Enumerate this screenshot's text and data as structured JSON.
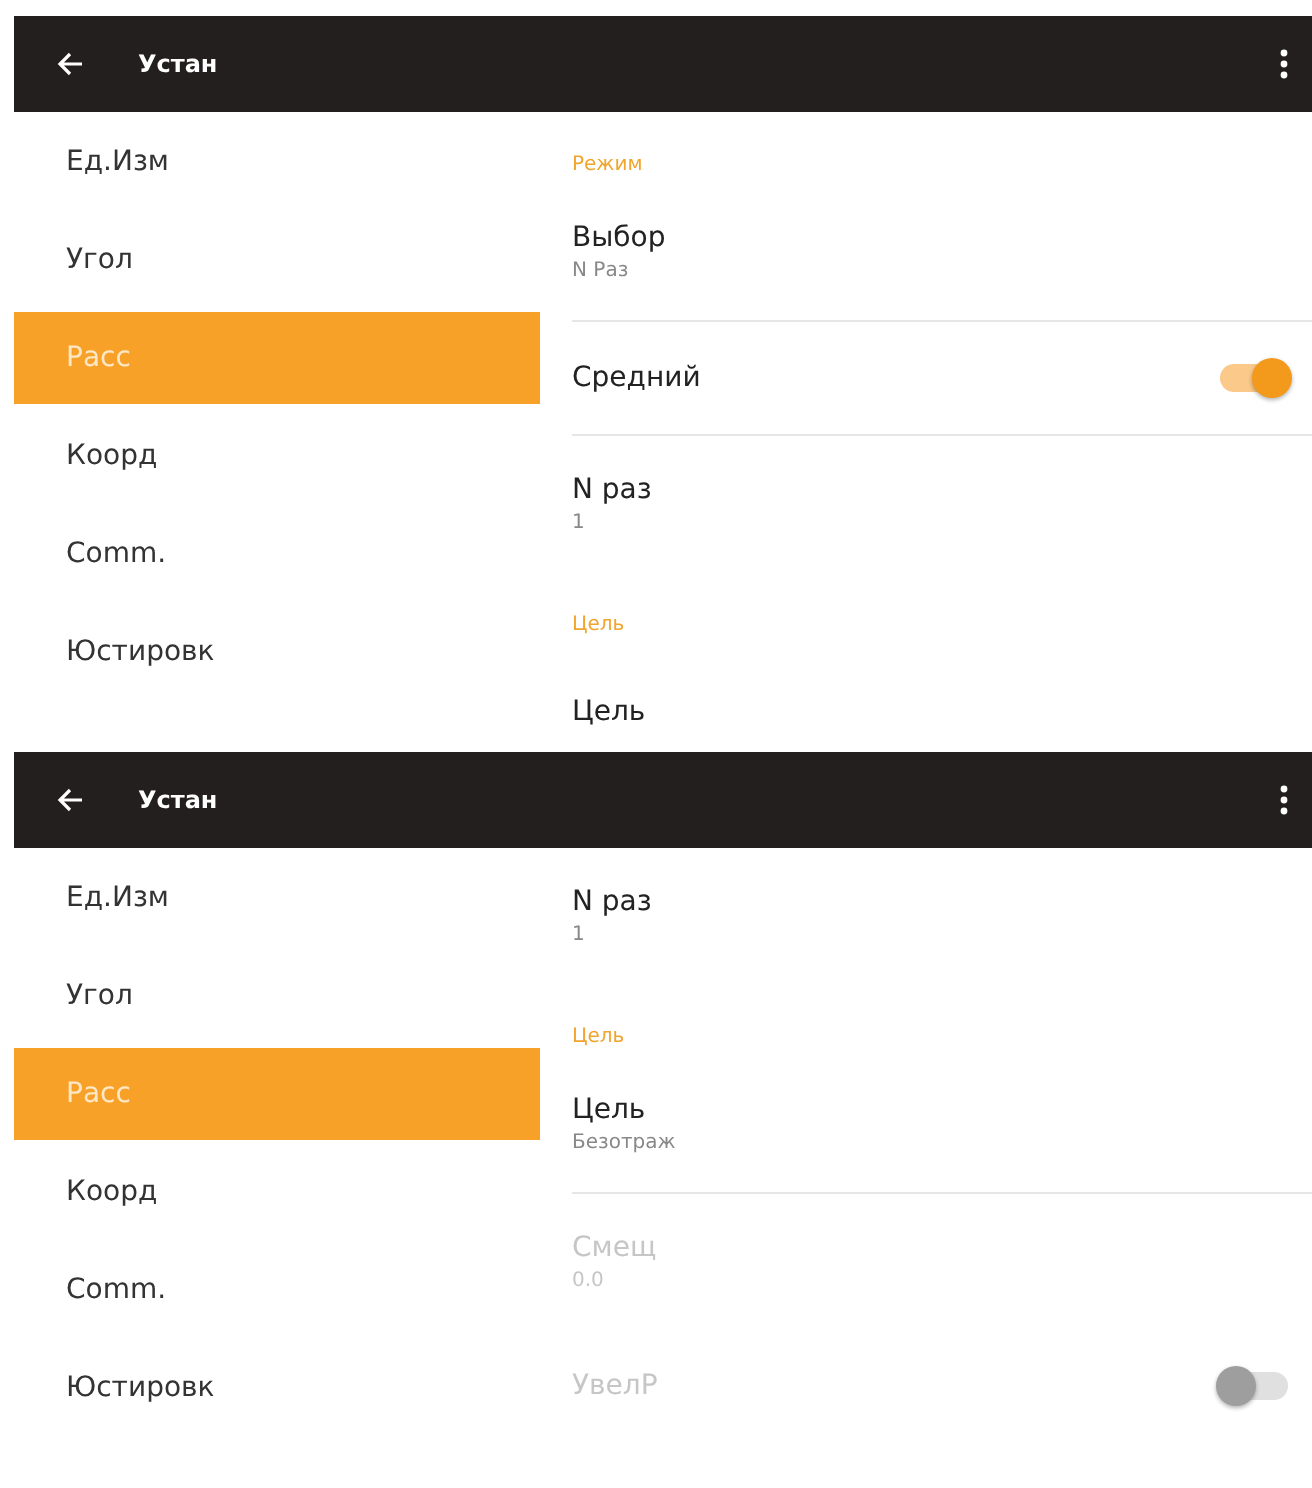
{
  "screens": [
    {
      "title": "Устан",
      "sidebar": {
        "items": [
          {
            "label": "Ед.Изм",
            "selected": false
          },
          {
            "label": "Угол",
            "selected": false
          },
          {
            "label": "Расс",
            "selected": true
          },
          {
            "label": "Коорд",
            "selected": false
          },
          {
            "label": "Comm.",
            "selected": false
          },
          {
            "label": "Юстировк",
            "selected": false
          }
        ]
      },
      "content": [
        {
          "kind": "section",
          "title": "Режим"
        },
        {
          "kind": "item",
          "title": "Выбор",
          "value": "N Раз",
          "disabled": false
        },
        {
          "kind": "divider"
        },
        {
          "kind": "toggle",
          "title": "Средний",
          "on": true,
          "disabled": false
        },
        {
          "kind": "divider"
        },
        {
          "kind": "item",
          "title": "N раз",
          "value": "1",
          "disabled": false
        },
        {
          "kind": "section",
          "title": "Цель"
        },
        {
          "kind": "item",
          "title": "Цель",
          "disabled": false
        }
      ]
    },
    {
      "title": "Устан",
      "sidebar": {
        "items": [
          {
            "label": "Ед.Изм",
            "selected": false
          },
          {
            "label": "Угол",
            "selected": false
          },
          {
            "label": "Расс",
            "selected": true
          },
          {
            "label": "Коорд",
            "selected": false
          },
          {
            "label": "Comm.",
            "selected": false
          },
          {
            "label": "Юстировк",
            "selected": false
          }
        ]
      },
      "content": [
        {
          "kind": "item",
          "title": "N раз",
          "value": "1",
          "disabled": false
        },
        {
          "kind": "section",
          "title": "Цель"
        },
        {
          "kind": "item",
          "title": "Цель",
          "value": "Безотраж",
          "disabled": false
        },
        {
          "kind": "divider"
        },
        {
          "kind": "item",
          "title": "Смещ",
          "value": "0.0",
          "disabled": true
        },
        {
          "kind": "toggle",
          "title": "УвелР",
          "on": false,
          "disabled": true
        }
      ]
    }
  ]
}
